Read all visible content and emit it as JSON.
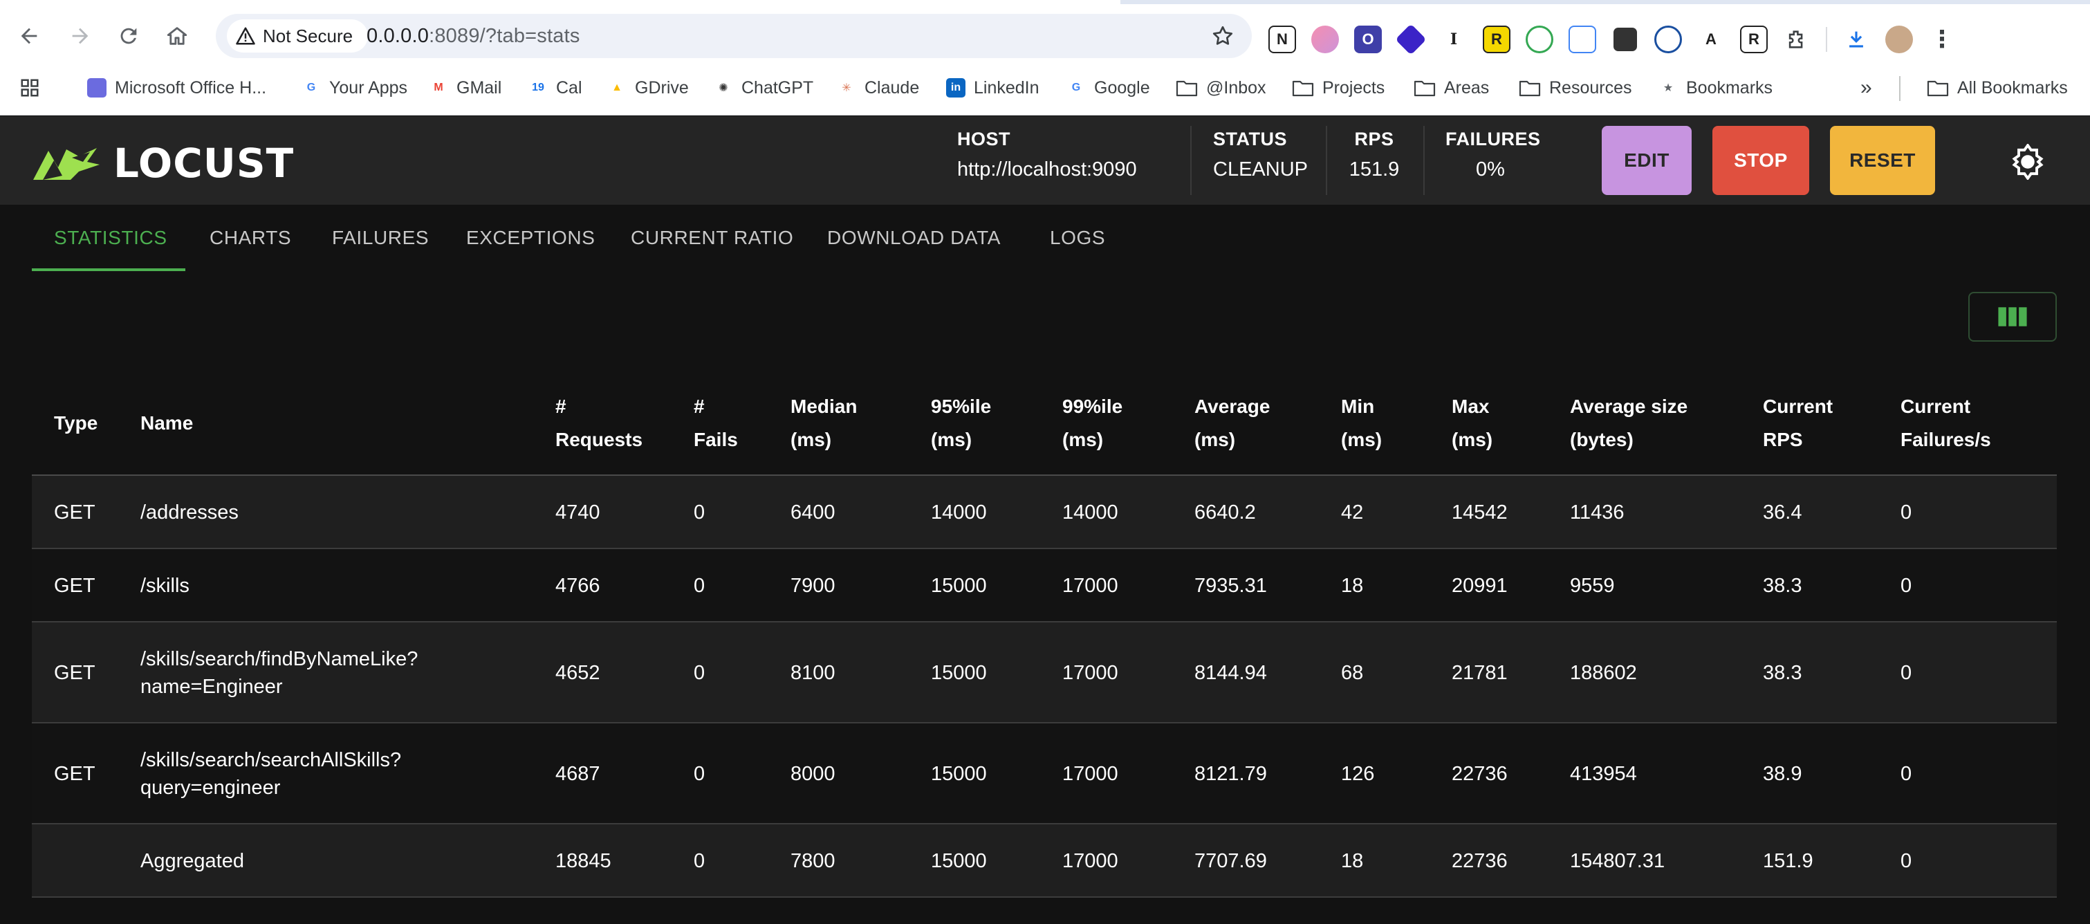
{
  "browser": {
    "security_label": "Not Secure",
    "url_host": "0.0.0.0",
    "url_rest": ":8089/?tab=stats",
    "bookmarks": [
      {
        "label": "Microsoft Office H...",
        "icon": "microsoft-copilot-icon"
      },
      {
        "label": "Your Apps",
        "icon": "google-g-icon"
      },
      {
        "label": "GMail",
        "icon": "gmail-icon"
      },
      {
        "label": "Cal",
        "icon": "calendar-icon"
      },
      {
        "label": "GDrive",
        "icon": "google-drive-icon"
      },
      {
        "label": "ChatGPT",
        "icon": "chatgpt-icon"
      },
      {
        "label": "Claude",
        "icon": "claude-icon"
      },
      {
        "label": "LinkedIn",
        "icon": "linkedin-icon"
      },
      {
        "label": "Google",
        "icon": "google-g-icon"
      },
      {
        "label": "@Inbox",
        "icon": "folder-icon"
      },
      {
        "label": "Projects",
        "icon": "folder-icon"
      },
      {
        "label": "Areas",
        "icon": "folder-icon"
      },
      {
        "label": "Resources",
        "icon": "folder-icon"
      },
      {
        "label": "Bookmarks",
        "icon": "star-icon"
      }
    ],
    "all_bookmarks_label": "All Bookmarks",
    "overflow_label": "»"
  },
  "header": {
    "logo_text": "LOCUST",
    "host_label": "HOST",
    "host_value": "http://localhost:9090",
    "status_label": "STATUS",
    "status_value": "CLEANUP",
    "rps_label": "RPS",
    "rps_value": "151.9",
    "failures_label": "FAILURES",
    "failures_value": "0%",
    "edit_label": "EDIT",
    "stop_label": "STOP",
    "reset_label": "RESET",
    "colors": {
      "edit": "#c794e0",
      "stop": "#e0503f",
      "reset": "#f2b63d",
      "accent": "#4caf50"
    }
  },
  "tabs": [
    "STATISTICS",
    "CHARTS",
    "FAILURES",
    "EXCEPTIONS",
    "CURRENT RATIO",
    "DOWNLOAD DATA",
    "LOGS"
  ],
  "table": {
    "headers": [
      [
        "Type"
      ],
      [
        "Name"
      ],
      [
        "#",
        "Requests"
      ],
      [
        "#",
        "Fails"
      ],
      [
        "Median",
        "(ms)"
      ],
      [
        "95%ile",
        "(ms)"
      ],
      [
        "99%ile",
        "(ms)"
      ],
      [
        "Average",
        "(ms)"
      ],
      [
        "Min",
        "(ms)"
      ],
      [
        "Max",
        "(ms)"
      ],
      [
        "Average size",
        "(bytes)"
      ],
      [
        "Current",
        "RPS"
      ],
      [
        "Current",
        "Failures/s"
      ]
    ],
    "rows": [
      [
        "GET",
        [
          "/addresses"
        ],
        "4740",
        "0",
        "6400",
        "14000",
        "14000",
        "6640.2",
        "42",
        "14542",
        "11436",
        "36.4",
        "0"
      ],
      [
        "GET",
        [
          "/skills"
        ],
        "4766",
        "0",
        "7900",
        "15000",
        "17000",
        "7935.31",
        "18",
        "20991",
        "9559",
        "38.3",
        "0"
      ],
      [
        "GET",
        [
          "/skills/search/findByNameLike?",
          "name=Engineer"
        ],
        "4652",
        "0",
        "8100",
        "15000",
        "17000",
        "8144.94",
        "68",
        "21781",
        "188602",
        "38.3",
        "0"
      ],
      [
        "GET",
        [
          "/skills/search/searchAllSkills?",
          "query=engineer"
        ],
        "4687",
        "0",
        "8000",
        "15000",
        "17000",
        "8121.79",
        "126",
        "22736",
        "413954",
        "38.9",
        "0"
      ],
      [
        "",
        [
          "Aggregated"
        ],
        "18845",
        "0",
        "7800",
        "15000",
        "17000",
        "7707.69",
        "18",
        "22736",
        "154807.31",
        "151.9",
        "0"
      ]
    ]
  }
}
